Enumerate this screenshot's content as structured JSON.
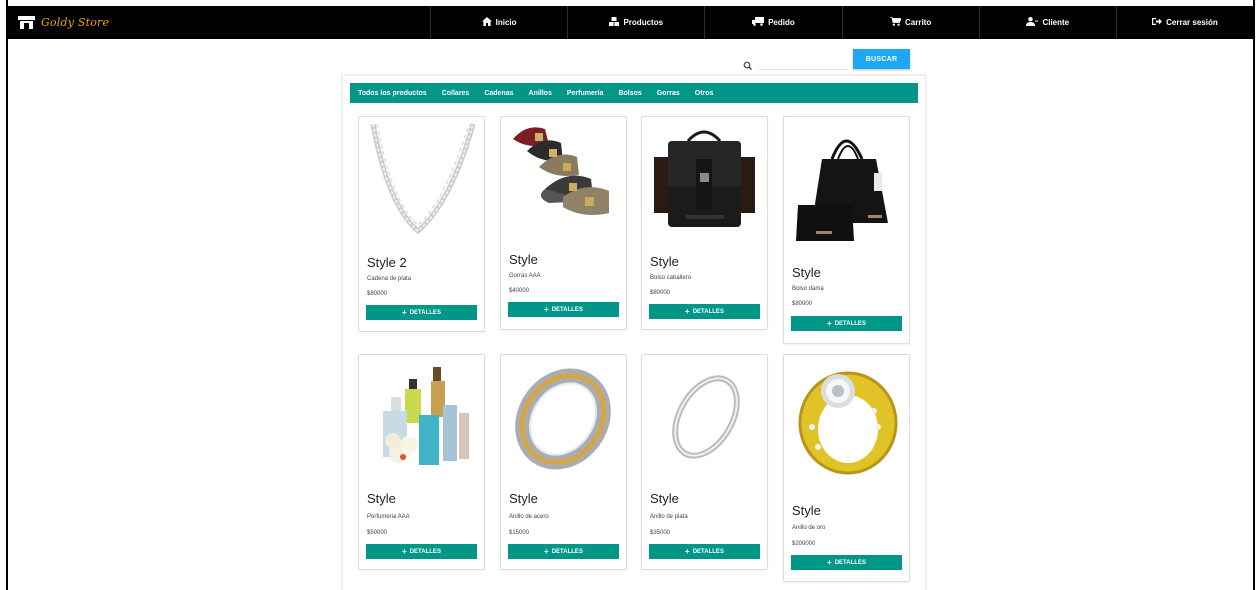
{
  "brand": {
    "name": "Goldy Store",
    "icon": "store-icon",
    "color": "#f2a20e"
  },
  "nav": [
    {
      "label": "Inicio",
      "icon": "home-icon"
    },
    {
      "label": "Productos",
      "icon": "cubes-icon"
    },
    {
      "label": "Pedido",
      "icon": "truck-icon"
    },
    {
      "label": "Carrito",
      "icon": "cart-icon"
    },
    {
      "label": "Cliente",
      "icon": "user-icon"
    },
    {
      "label": "Cerrar sesión",
      "icon": "sign-out-icon"
    }
  ],
  "search": {
    "placeholder": "",
    "value": "",
    "button_label": "BUSCAR"
  },
  "categories": [
    "Todos los productos",
    "Collares",
    "Cadenas",
    "Anillos",
    "Perfumería",
    "Bolsos",
    "Gorras",
    "Otros"
  ],
  "colors": {
    "accent": "#009688",
    "search_button": "#1ea7f2",
    "navbar": "#000000"
  },
  "products": [
    {
      "title": "Style 2",
      "description": "Cadena de plata",
      "price": "$80000",
      "button": "DETALLES",
      "image": "silver-chain"
    },
    {
      "title": "Style",
      "description": "Gorras AAA",
      "price": "$40000",
      "button": "DETALLES",
      "image": "trucker-caps"
    },
    {
      "title": "Style",
      "description": "Bolso caballero",
      "price": "$80000",
      "button": "DETALLES",
      "image": "leather-messenger-bag"
    },
    {
      "title": "Style",
      "description": "Bolso dama",
      "price": "$80000",
      "button": "DETALLES",
      "image": "black-handbag"
    },
    {
      "title": "Style",
      "description": "Perfumeria AAA",
      "price": "$50000",
      "button": "DETALLES",
      "image": "perfume-bottles"
    },
    {
      "title": "Style",
      "description": "Anillo de acero",
      "price": "$15000",
      "button": "DETALLES",
      "image": "steel-gold-ring"
    },
    {
      "title": "Style",
      "description": "Anillo de plata",
      "price": "$35000",
      "button": "DETALLES",
      "image": "silver-ring"
    },
    {
      "title": "Style",
      "description": "Anillo de oro",
      "price": "$200000",
      "button": "DETALLES",
      "image": "gold-ring"
    }
  ]
}
